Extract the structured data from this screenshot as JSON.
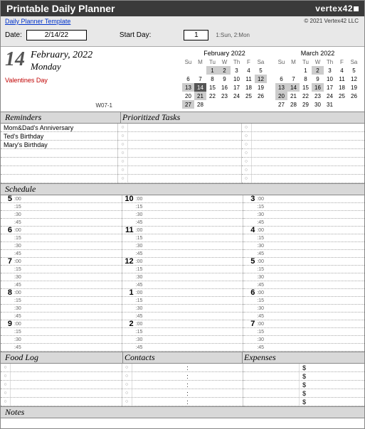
{
  "header": {
    "title": "Printable Daily Planner",
    "brand": "vertex42"
  },
  "subheader": {
    "template_link": "Daily Planner Template",
    "copyright": "© 2021 Vertex42 LLC"
  },
  "inputs": {
    "date_label": "Date:",
    "date_value": "2/14/22",
    "startday_label": "Start Day:",
    "startday_value": "1",
    "startday_hint": "1:Sun, 2:Mon"
  },
  "dateblock": {
    "daynum": "14",
    "monthyear": "February, 2022",
    "weekday": "Monday",
    "event": "Valentines Day",
    "weekno": "W07-1"
  },
  "minical1": {
    "title": "February 2022",
    "dow": [
      "Su",
      "M",
      "Tu",
      "W",
      "Th",
      "F",
      "Sa"
    ],
    "weeks": [
      [
        {
          "d": ""
        },
        {
          "d": ""
        },
        {
          "d": "1",
          "hl": true
        },
        {
          "d": "2",
          "hl": true
        },
        {
          "d": "3"
        },
        {
          "d": "4"
        },
        {
          "d": "5"
        }
      ],
      [
        {
          "d": "6"
        },
        {
          "d": "7"
        },
        {
          "d": "8"
        },
        {
          "d": "9"
        },
        {
          "d": "10"
        },
        {
          "d": "11"
        },
        {
          "d": "12",
          "hl": true
        }
      ],
      [
        {
          "d": "13",
          "hl": true
        },
        {
          "d": "14",
          "today": true
        },
        {
          "d": "15"
        },
        {
          "d": "16"
        },
        {
          "d": "17"
        },
        {
          "d": "18"
        },
        {
          "d": "19"
        }
      ],
      [
        {
          "d": "20"
        },
        {
          "d": "21",
          "hl": true
        },
        {
          "d": "22"
        },
        {
          "d": "23"
        },
        {
          "d": "24"
        },
        {
          "d": "25"
        },
        {
          "d": "26"
        }
      ],
      [
        {
          "d": "27",
          "hl": true
        },
        {
          "d": "28"
        },
        {
          "d": ""
        },
        {
          "d": ""
        },
        {
          "d": ""
        },
        {
          "d": ""
        },
        {
          "d": ""
        }
      ]
    ]
  },
  "minical2": {
    "title": "March 2022",
    "dow": [
      "Su",
      "M",
      "Tu",
      "W",
      "Th",
      "F",
      "Sa"
    ],
    "weeks": [
      [
        {
          "d": ""
        },
        {
          "d": ""
        },
        {
          "d": "1"
        },
        {
          "d": "2",
          "hl": true
        },
        {
          "d": "3"
        },
        {
          "d": "4"
        },
        {
          "d": "5"
        }
      ],
      [
        {
          "d": "6"
        },
        {
          "d": "7"
        },
        {
          "d": "8"
        },
        {
          "d": "9"
        },
        {
          "d": "10"
        },
        {
          "d": "11"
        },
        {
          "d": "12"
        }
      ],
      [
        {
          "d": "13",
          "hl": true
        },
        {
          "d": "14",
          "hl": true
        },
        {
          "d": "15"
        },
        {
          "d": "16",
          "hl": true
        },
        {
          "d": "17"
        },
        {
          "d": "18"
        },
        {
          "d": "19"
        }
      ],
      [
        {
          "d": "20",
          "hl": true
        },
        {
          "d": "21"
        },
        {
          "d": "22"
        },
        {
          "d": "23"
        },
        {
          "d": "24"
        },
        {
          "d": "25"
        },
        {
          "d": "26"
        }
      ],
      [
        {
          "d": "27"
        },
        {
          "d": "28"
        },
        {
          "d": "29"
        },
        {
          "d": "30"
        },
        {
          "d": "31"
        },
        {
          "d": ""
        },
        {
          "d": ""
        }
      ]
    ]
  },
  "sections": {
    "reminders": "Reminders",
    "tasks": "Prioritized Tasks",
    "schedule": "Schedule",
    "foodlog": "Food Log",
    "contacts": "Contacts",
    "expenses": "Expenses",
    "notes": "Notes"
  },
  "reminders": [
    "Mom&Dad's Anniversary",
    "Ted's Birthday",
    "Mary's Birthday",
    "",
    "",
    "",
    ""
  ],
  "task_rows": 7,
  "schedule": {
    "mins": [
      ":00",
      ":15",
      ":30",
      ":45"
    ],
    "col1": [
      "5",
      "6",
      "7",
      "8",
      "9"
    ],
    "col2": [
      "10",
      "11",
      "12",
      "1",
      "2"
    ],
    "col3": [
      "3",
      "4",
      "5",
      "6",
      "7"
    ]
  },
  "bottom_rows": 5,
  "expense_symbol": "$"
}
